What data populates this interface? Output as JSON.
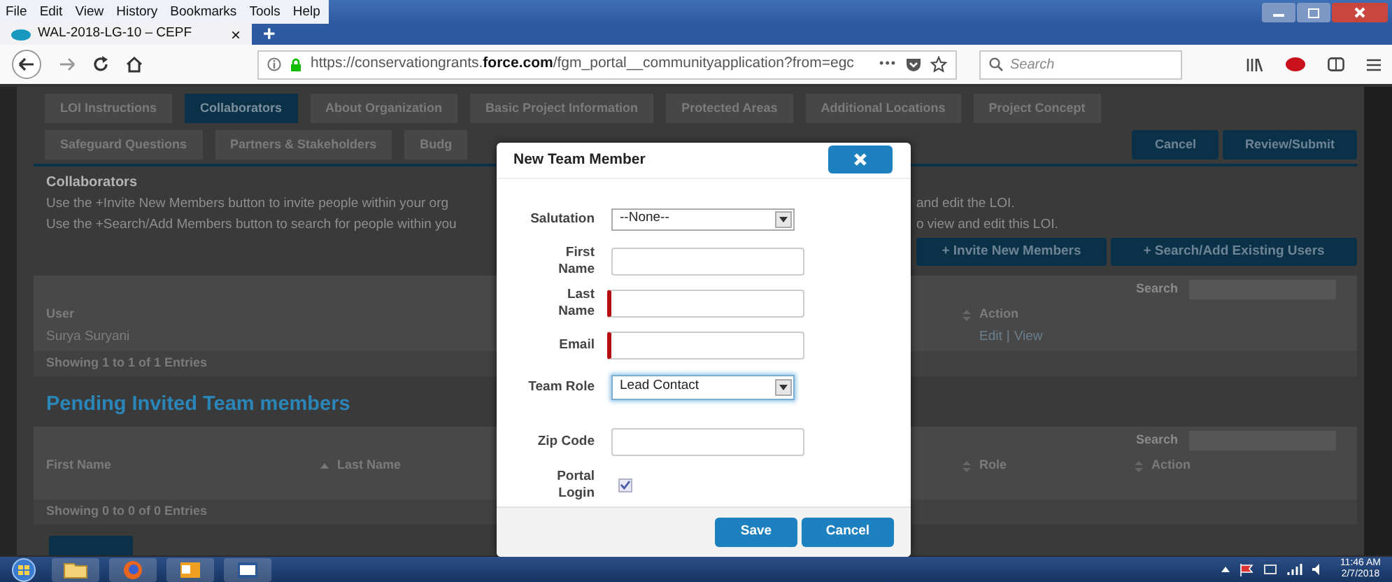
{
  "browser": {
    "menu": [
      "File",
      "Edit",
      "View",
      "History",
      "Bookmarks",
      "Tools",
      "Help"
    ],
    "tab": {
      "title": "WAL-2018-LG-10 – CEPF",
      "close": "×",
      "new_tab": "+"
    },
    "url": "https://conservationgrants.**force.com**/fgm_portal__communityapplication?from=egc",
    "page_actions": "•••",
    "search": {
      "placeholder": "Search"
    }
  },
  "page": {
    "tab_rows": [
      [
        {
          "label": "LOI Instructions",
          "selected": false
        },
        {
          "label": "Collaborators",
          "selected": true
        },
        {
          "label": "About Organization",
          "selected": false
        },
        {
          "label": "Basic Project Information",
          "selected": false
        },
        {
          "label": "Protected Areas",
          "selected": false
        },
        {
          "label": "Additional Locations",
          "selected": false
        },
        {
          "label": "Project Concept",
          "selected": false
        }
      ],
      [
        {
          "label": "Safeguard Questions",
          "selected": false
        },
        {
          "label": "Partners & Stakeholders",
          "selected": false
        },
        {
          "label": "Budg",
          "selected": false
        }
      ]
    ],
    "header_buttons": [
      "Cancel",
      "Review/Submit"
    ],
    "section": {
      "title": "Collaborators",
      "lines": [
        {
          "start": "Use the +Invite New Members button to invite people within your org",
          "end": "and edit the LOI."
        },
        {
          "start": "Use the +Search/Add Members button to search for people within you",
          "end": "o view and edit this LOI."
        }
      ]
    },
    "buttons": [
      "+ Invite New Members",
      "+ Search/Add Existing Users"
    ],
    "members_table": {
      "search_label": "Search",
      "columns": [
        {
          "label": "User",
          "sortable": false
        },
        {
          "label": "Action",
          "sortable": true,
          "sorted": false
        }
      ],
      "rows": [
        {
          "user": "Surya Suryani",
          "actions": [
            "Edit",
            "View"
          ],
          "separator": "|"
        }
      ],
      "info": "Showing 1 to 1 of 1 Entries"
    },
    "pending": {
      "title": "Pending Invited Team members",
      "search_label": "Search",
      "columns": [
        {
          "label": "First Name",
          "sortable": false
        },
        {
          "label": "Last Name",
          "sortable": true,
          "sorted": true
        },
        {
          "label": "Role",
          "sortable": true,
          "sorted": false
        },
        {
          "label": "Action",
          "sortable": true,
          "sorted": false
        }
      ],
      "info": "Showing 0 to 0 of 0 Entries"
    }
  },
  "modal": {
    "title": "New Team Member",
    "fields": [
      {
        "kind": "select",
        "label": "Salutation",
        "value": "--None--",
        "focused": false
      },
      {
        "kind": "text",
        "label": "First Name",
        "required": false,
        "wrapped": true
      },
      {
        "kind": "text",
        "label": "Last Name",
        "required": true,
        "wrapped": true
      },
      {
        "kind": "text",
        "label": "Email",
        "required": true
      },
      {
        "kind": "select",
        "label": "Team Role",
        "value": "Lead Contact",
        "focused": true,
        "wrapped": false
      },
      {
        "kind": "text",
        "label": "Zip Code",
        "required": false,
        "wrapped": false
      },
      {
        "kind": "checkbox",
        "label": "Portal Login",
        "checked": true,
        "wrapped": true
      }
    ],
    "buttons": [
      "Save",
      "Cancel"
    ]
  },
  "taskbar": {
    "time": "11:46 AM",
    "date": "2/7/2018"
  }
}
